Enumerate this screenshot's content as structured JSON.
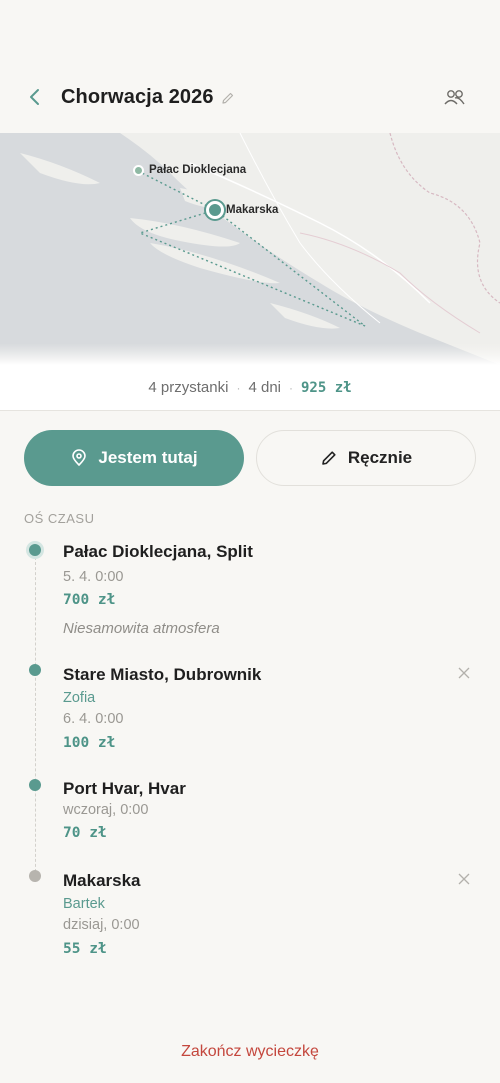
{
  "header": {
    "title": "Chorwacja 2026",
    "back_icon": "chevron-left-icon",
    "edit_icon": "pencil-icon",
    "group_icon": "users-icon"
  },
  "map": {
    "labels": {
      "palace": "Pałac Dioklecjana",
      "makarska": "Makarska"
    }
  },
  "summary": {
    "stops": "4 przystanki",
    "days": "4 dni",
    "separator": "·",
    "cost": "925 zł"
  },
  "actions": {
    "here_label": "Jestem tutaj",
    "here_icon": "location-pin-icon",
    "manual_label": "Ręcznie",
    "manual_icon": "pencil-icon"
  },
  "timeline": {
    "section_label": "OŚ CZASU",
    "stops": [
      {
        "name": "Pałac Dioklecjana, Split",
        "time": "5. 4. 0:00",
        "cost": "700 zł",
        "note": "Niesamowita atmosfera"
      },
      {
        "name": "Stare Miasto, Dubrownik",
        "person": "Zofia",
        "time": "6. 4. 0:00",
        "cost": "100 zł"
      },
      {
        "name": "Port Hvar, Hvar",
        "time": "wczoraj, 0:00",
        "cost": "70 zł"
      },
      {
        "name": "Makarska",
        "person": "Bartek",
        "time": "dzisiaj, 0:00",
        "cost": "55 zł"
      }
    ]
  },
  "footer": {
    "end_trip": "Zakończ wycieczkę"
  },
  "colors": {
    "accent": "#5a9a8f",
    "danger": "#c4473d",
    "background": "#f8f7f4"
  }
}
